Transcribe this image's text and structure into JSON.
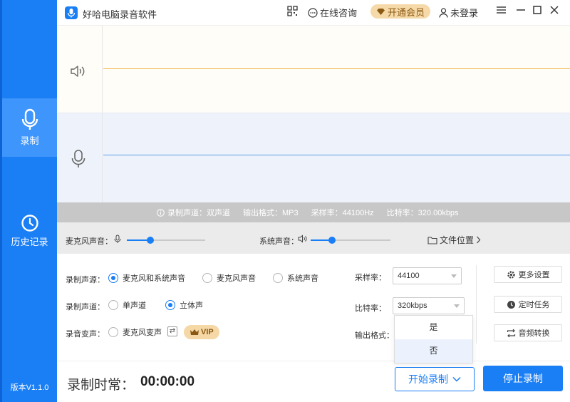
{
  "app": {
    "title": "好哈电脑录音软件",
    "version": "版本V1.1.0"
  },
  "titlebar": {
    "consult": "在线咨询",
    "vip_open": "开通会员",
    "login": "未登录"
  },
  "sidebar": {
    "items": [
      {
        "label": "录制",
        "icon": "microphone-icon",
        "active": true
      },
      {
        "label": "历史记录",
        "icon": "clock-icon",
        "active": false
      }
    ]
  },
  "info_bar": {
    "channel": "录制声道：双声道",
    "format": "输出格式：MP3",
    "sample_rate": "采样率：44100Hz",
    "bitrate": "比特率：320.00kbps"
  },
  "volume": {
    "mic_label": "麦克风声音：",
    "mic_level": 0.3,
    "system_label": "系统声音：",
    "system_level": 0.27,
    "file_location": "文件位置"
  },
  "settings": {
    "source_label": "录制声源：",
    "sources": [
      "麦克风和系统声音",
      "麦克风声音",
      "系统声音"
    ],
    "source_selected": 0,
    "channel_label": "录制声道：",
    "channels": [
      "单声道",
      "立体声"
    ],
    "channel_selected": 1,
    "voice_change_label": "录音变声：",
    "voice_change_option": "麦克风变声",
    "vip_badge": "VIP",
    "sample_rate_label": "采样率：",
    "sample_rate_value": "44100",
    "bitrate_label": "比特率：",
    "bitrate_value": "320kbps",
    "output_format_label": "输出格式：",
    "dropdown_options": [
      "是",
      "否"
    ],
    "buttons": [
      "更多设置",
      "定时任务",
      "音频转换"
    ]
  },
  "bottom": {
    "duration_label": "录制时常：",
    "duration_value": "00:00:00",
    "start_label": "开始录制",
    "stop_label": "停止录制"
  },
  "colors": {
    "accent": "#1a7ef5",
    "vip": "#f5d8a6",
    "speaker_wave": "#f2b441",
    "mic_wave": "#5c9ae8"
  }
}
